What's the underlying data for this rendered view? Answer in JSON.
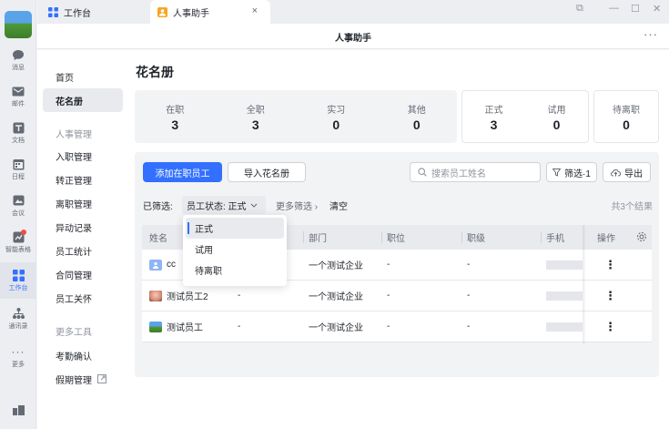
{
  "rail": {
    "items": [
      {
        "label": "消息",
        "icon": "chat-icon"
      },
      {
        "label": "邮件",
        "icon": "mail-icon"
      },
      {
        "label": "文档",
        "icon": "doc-icon"
      },
      {
        "label": "日程",
        "icon": "calendar-icon"
      },
      {
        "label": "会议",
        "icon": "meeting-icon"
      },
      {
        "label": "智能表格",
        "icon": "smart-table-icon"
      },
      {
        "label": "工作台",
        "icon": "workbench-icon"
      },
      {
        "label": "通讯录",
        "icon": "contacts-icon"
      },
      {
        "label": "更多",
        "icon": "more-icon"
      }
    ]
  },
  "tabs": [
    {
      "label": "工作台"
    },
    {
      "label": "人事助手",
      "close": "×"
    }
  ],
  "window_controls": {
    "restore": "⧉",
    "minimize": "—",
    "maximize": "☐",
    "close": "✕"
  },
  "titlebar": {
    "title": "人事助手",
    "more": "···"
  },
  "sidenav": {
    "items": [
      {
        "label": "首页"
      },
      {
        "label": "花名册"
      },
      {
        "label": "入职管理"
      },
      {
        "label": "转正管理"
      },
      {
        "label": "离职管理"
      },
      {
        "label": "异动记录"
      },
      {
        "label": "员工统计"
      },
      {
        "label": "合同管理"
      },
      {
        "label": "员工关怀"
      },
      {
        "label": "考勤确认"
      },
      {
        "label": "假期管理"
      }
    ],
    "groups": [
      "人事管理",
      "更多工具"
    ]
  },
  "main": {
    "title": "花名册",
    "stats": [
      {
        "label": "在职",
        "value": "3"
      },
      {
        "label": "全职",
        "value": "3"
      },
      {
        "label": "实习",
        "value": "0"
      },
      {
        "label": "其他",
        "value": "0"
      }
    ],
    "stats2": [
      {
        "label": "正式",
        "value": "3"
      },
      {
        "label": "试用",
        "value": "0"
      }
    ],
    "stats3": [
      {
        "label": "待离职",
        "value": "0"
      }
    ],
    "buttons": {
      "add": "添加在职员工",
      "import": "导入花名册",
      "filter": "筛选·1",
      "export": "导出"
    },
    "search_placeholder": "搜索员工姓名",
    "filter": {
      "label": "已筛选:",
      "chip": "员工状态: 正式",
      "more": "更多筛选",
      "clear": "清空",
      "result": "共3个结果"
    },
    "table": {
      "headers": [
        "姓名",
        "部门",
        "职位",
        "职级",
        "手机",
        "操作"
      ],
      "rows": [
        {
          "name": "cc",
          "dept": "一个测试企业",
          "pos": "-",
          "level": "-",
          "extra": ""
        },
        {
          "name": "测试员工2",
          "dept": "一个测试企业",
          "pos": "-",
          "level": "-",
          "extra": "-"
        },
        {
          "name": "测试员工",
          "dept": "一个测试企业",
          "pos": "-",
          "level": "-",
          "extra": "-"
        }
      ],
      "op": "⋮"
    },
    "dropdown": {
      "options": [
        "正式",
        "试用",
        "待离职"
      ],
      "selected": "正式"
    }
  },
  "colors": {
    "accent": "#3370ff",
    "badge": "#f54a45"
  }
}
